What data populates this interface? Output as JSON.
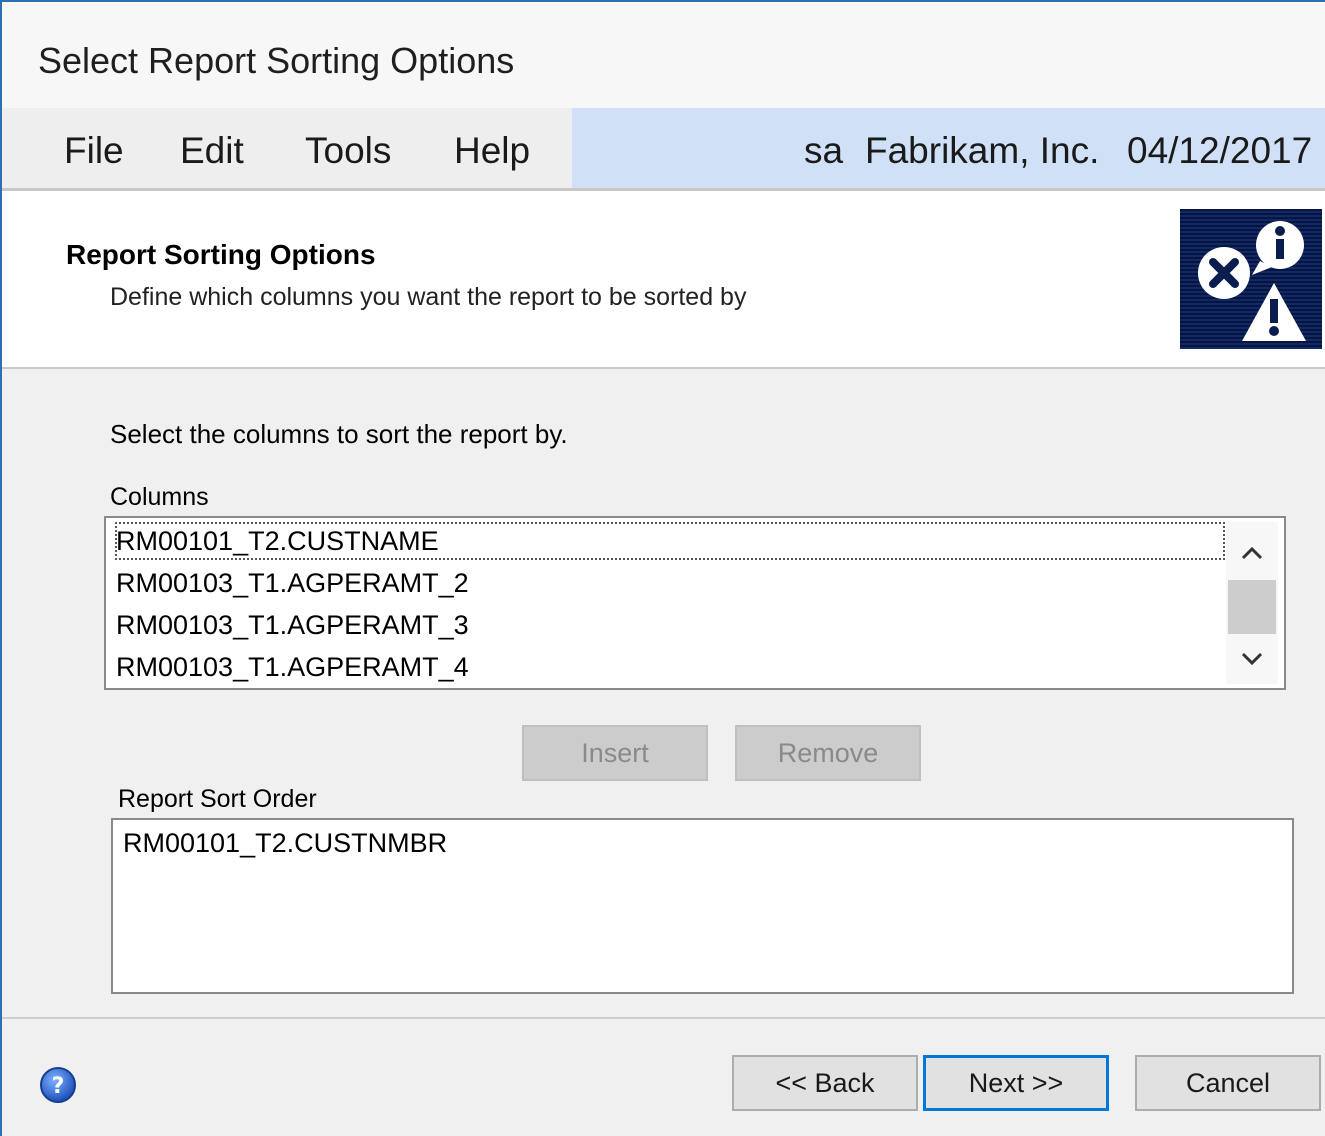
{
  "window": {
    "title": "Select Report Sorting Options"
  },
  "menu": {
    "file": "File",
    "edit": "Edit",
    "tools": "Tools",
    "help": "Help"
  },
  "session": {
    "user": "sa",
    "company": "Fabrikam, Inc.",
    "date": "04/12/2017"
  },
  "header": {
    "title": "Report Sorting Options",
    "subtitle": "Define which columns you want the report to be sorted by",
    "icon": "info-error-warning-icon"
  },
  "main": {
    "instruction": "Select the columns to sort the report by.",
    "columns_label": "Columns",
    "columns": [
      "RM00101_T2.CUSTNAME",
      "RM00103_T1.AGPERAMT_2",
      "RM00103_T1.AGPERAMT_3",
      "RM00103_T1.AGPERAMT_4"
    ],
    "insert_label": "Insert",
    "remove_label": "Remove",
    "sort_order_label": "Report Sort Order",
    "sort_order": [
      "RM00101_T2.CUSTNMBR"
    ]
  },
  "footer": {
    "back_label": "<< Back",
    "next_label": "Next >>",
    "cancel_label": "Cancel",
    "help_icon": "help-icon"
  }
}
